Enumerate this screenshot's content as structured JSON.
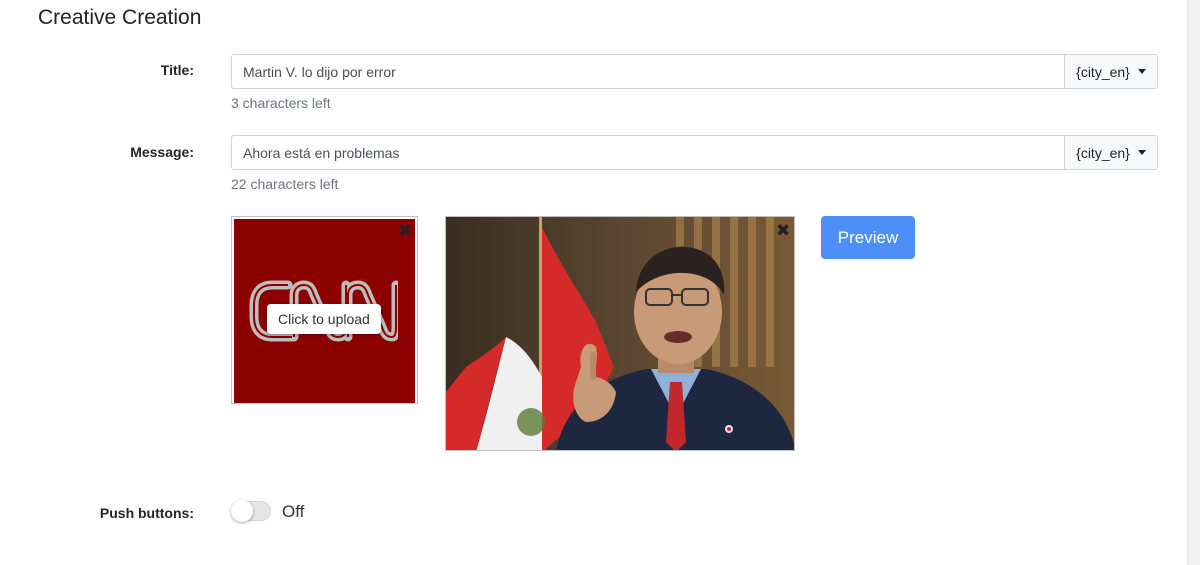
{
  "page": {
    "title": "Creative Creation"
  },
  "form": {
    "title_field": {
      "label": "Title:",
      "value": "Martin V. lo dijo por error",
      "macro_label": "{city_en}",
      "help": "3 characters left"
    },
    "message_field": {
      "label": "Message:",
      "value": "Ahora está en problemas",
      "macro_label": "{city_en}",
      "help": "22 characters left"
    },
    "logo": {
      "upload_label": "Click to upload",
      "close_glyph": "✖",
      "background_color": "#8b0000"
    },
    "image": {
      "close_glyph": "✖"
    },
    "preview_label": "Preview",
    "push_buttons": {
      "label": "Push buttons:",
      "state_label": "Off",
      "enabled": false
    }
  },
  "colors": {
    "accent": "#4e8ef7"
  }
}
